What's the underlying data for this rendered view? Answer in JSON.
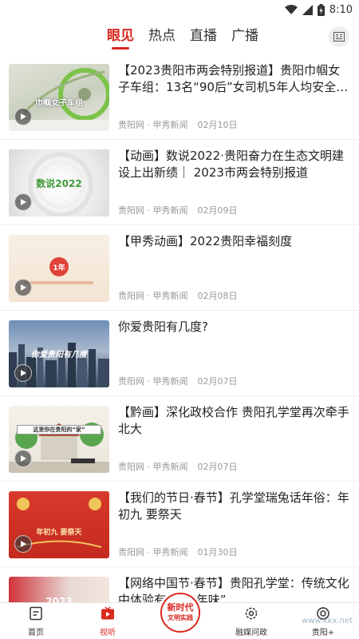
{
  "status_bar": {
    "time": "8:10"
  },
  "top_nav": {
    "tabs": [
      {
        "label": "眼见",
        "active": true
      },
      {
        "label": "热点",
        "active": false
      },
      {
        "label": "直播",
        "active": false
      },
      {
        "label": "广播",
        "active": false
      }
    ]
  },
  "feed": {
    "items": [
      {
        "title": "【2023贵阳市两会特别报道】贵阳巾帼女子车组：13名“90后”女司机5年人均安全驾驶…",
        "source": "贵阳网 · 甲秀新闻",
        "date": "02月10日",
        "thumb_text": "巾帼女子车组"
      },
      {
        "title": "【动画】数说2022·贵阳奋力在生态文明建设上出新绩｜ 2023市两会特别报道",
        "source": "贵阳网 · 甲秀新闻",
        "date": "02月09日",
        "thumb_text": "数说2022"
      },
      {
        "title": "【甲秀动画】2022贵阳幸福刻度",
        "source": "贵阳网 · 甲秀新闻",
        "date": "02月08日",
        "thumb_text": "1年"
      },
      {
        "title": "你爱贵阳有几度?",
        "source": "贵阳网 · 甲秀新闻",
        "date": "02月07日",
        "thumb_text": "你爱贵阳有几度"
      },
      {
        "title": "【黔画】深化政校合作 贵阳孔学堂再次牵手北大",
        "source": "贵阳网 · 甲秀新闻",
        "date": "02月07日",
        "thumb_text": "这里你在贵阳的“家”"
      },
      {
        "title": "【我们的节日·春节】孔学堂瑞兔话年俗：年初九 要祭天",
        "source": "贵阳网 · 甲秀新闻",
        "date": "01月30日",
        "thumb_text": "年初九 要祭天"
      },
      {
        "title": "【网络中国节·春节】贵阳孔学堂：传统文化中体验有趣的“年味”",
        "source": "贵阳网 · 甲秀新闻",
        "date": "",
        "thumb_text": "2023"
      }
    ]
  },
  "bottom_nav": {
    "items": [
      {
        "label": "首页",
        "active": false
      },
      {
        "label": "视听",
        "active": true
      },
      {
        "label": "融媒问政",
        "active": false
      },
      {
        "label": "贵阳+",
        "active": false
      }
    ],
    "center_badge": {
      "line1": "新时代",
      "line2": "文明实践"
    }
  },
  "watermark": {
    "text": "www.kkx.net"
  }
}
